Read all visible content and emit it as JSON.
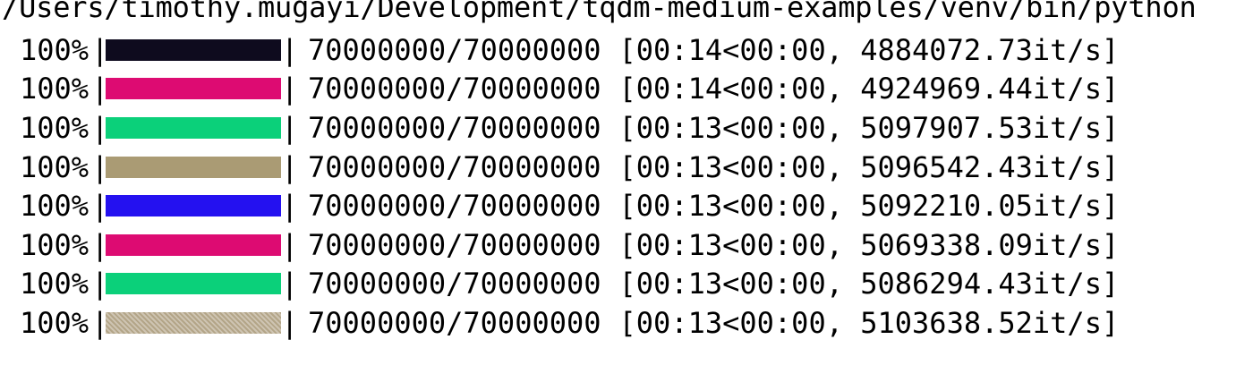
{
  "terminal": {
    "path": "/Users/timothy.mugayi/Development/tqdm-medium-examples/venv/bin/python",
    "bar_left_edge": "|",
    "bar_right_edge": "|",
    "rows": [
      {
        "percent": "100%",
        "progress": 1.0,
        "color": "#0e0b1e",
        "dither": false,
        "count": "70000000/70000000",
        "timing": "[00:14<00:00, 4884072.73it/s]"
      },
      {
        "percent": "100%",
        "progress": 1.0,
        "color": "#dd0b72",
        "dither": false,
        "count": "70000000/70000000",
        "timing": "[00:14<00:00, 4924969.44it/s]"
      },
      {
        "percent": "100%",
        "progress": 1.0,
        "color": "#0bd07a",
        "dither": false,
        "count": "70000000/70000000",
        "timing": "[00:13<00:00, 5097907.53it/s]"
      },
      {
        "percent": "100%",
        "progress": 1.0,
        "color": "#aa9b74",
        "dither": false,
        "count": "70000000/70000000",
        "timing": "[00:13<00:00, 5096542.43it/s]"
      },
      {
        "percent": "100%",
        "progress": 1.0,
        "color": "#2411f0",
        "dither": false,
        "count": "70000000/70000000",
        "timing": "[00:13<00:00, 5092210.05it/s]"
      },
      {
        "percent": "100%",
        "progress": 1.0,
        "color": "#dd0b72",
        "dither": false,
        "count": "70000000/70000000",
        "timing": "[00:13<00:00, 5069338.09it/s]"
      },
      {
        "percent": "100%",
        "progress": 1.0,
        "color": "#0bd07a",
        "dither": false,
        "count": "70000000/70000000",
        "timing": "[00:13<00:00, 5086294.43it/s]"
      },
      {
        "percent": "100%",
        "progress": 1.0,
        "color": "#b3a588",
        "dither": true,
        "count": "70000000/70000000",
        "timing": "[00:13<00:00, 5103638.52it/s]"
      }
    ]
  }
}
